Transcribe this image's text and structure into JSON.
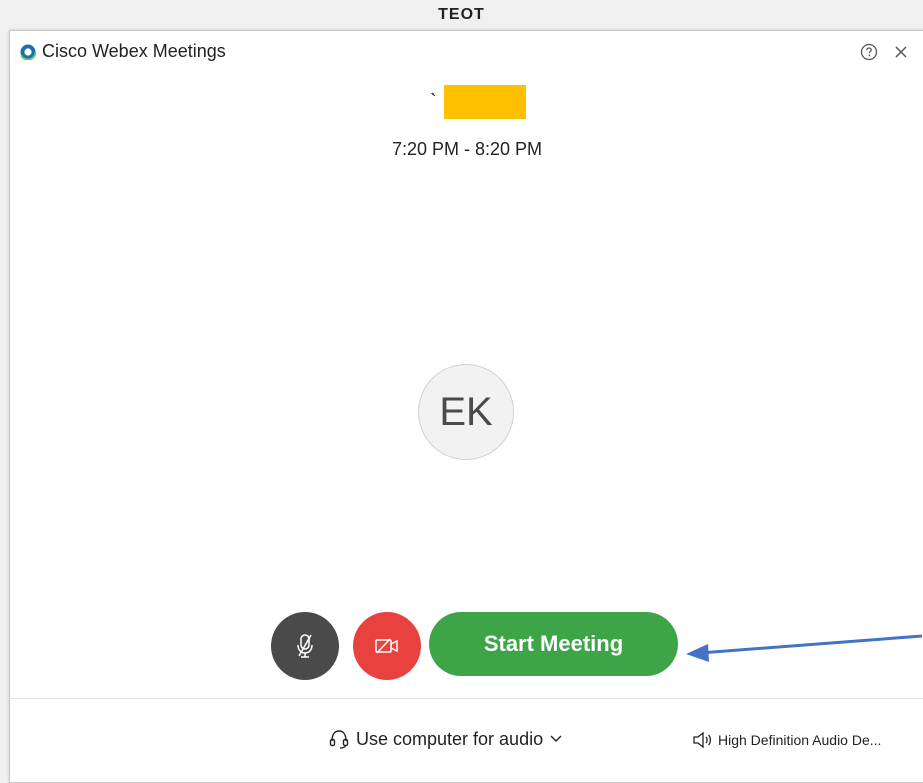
{
  "caption": "TEOT",
  "window": {
    "title": "Cisco Webex Meetings"
  },
  "meeting": {
    "title_partial": "`",
    "time": "7:20 PM - 8:20 PM"
  },
  "avatar": {
    "initials": "EK"
  },
  "controls": {
    "start_label": "Start Meeting"
  },
  "audio": {
    "option_label": "Use computer for audio",
    "device_label": "High Definition Audio De..."
  },
  "colors": {
    "start": "#3da548",
    "video_off": "#e8423e",
    "mute": "#4a4a4a",
    "redaction": "#ffc000",
    "annotation": "#4472c4"
  },
  "icons": {
    "app": "webex-logo-icon",
    "help": "help-circle-icon",
    "close": "close-icon",
    "mute": "mic-off-icon",
    "video": "video-off-icon",
    "headset": "headset-icon",
    "chevron": "chevron-down-icon",
    "speaker": "speaker-icon"
  }
}
